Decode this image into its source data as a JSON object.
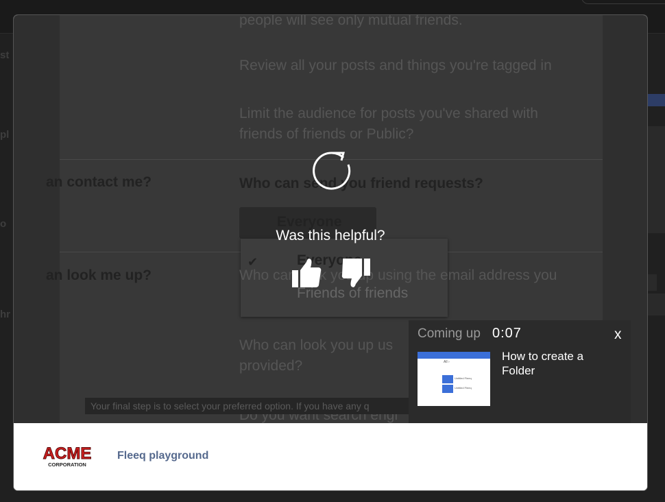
{
  "video": {
    "lines": [
      "people will see only mutual friends.",
      "Review all your posts and things you're tagged in",
      "Limit the audience for posts you've shared with",
      "friends of friends or Public?",
      "Who can send you friend requests?",
      "Everyone",
      "Everyone",
      "Friends of friends",
      "Who can look you up using the email address you",
      "provided?",
      "Who can look you up us",
      "provided?",
      "Do you want search engi"
    ],
    "left_labels": [
      "an contact me?",
      "an look me up?"
    ],
    "caption": "Your final step is to select your preferred option. If you have any q"
  },
  "overlay": {
    "helpful_question": "Was this helpful?",
    "replay_icon": "replay-icon",
    "thumbs_up_icon": "thumbs-up-icon",
    "thumbs_down_icon": "thumbs-down-icon"
  },
  "coming_up": {
    "label": "Coming up",
    "time": "0:07",
    "close": "x",
    "next_title": "How to create a Folder",
    "thumb_text": [
      "All ›",
      "Untitled Fleeq",
      "Untitled Fleeq"
    ]
  },
  "footer": {
    "logo_top": "ACME",
    "logo_bottom": "CORPORATION",
    "link": "Fleeq playground"
  },
  "colors": {
    "overlay_bg": "#2f2f2f",
    "footer_link": "#55698d",
    "logo_red": "#d22020"
  }
}
